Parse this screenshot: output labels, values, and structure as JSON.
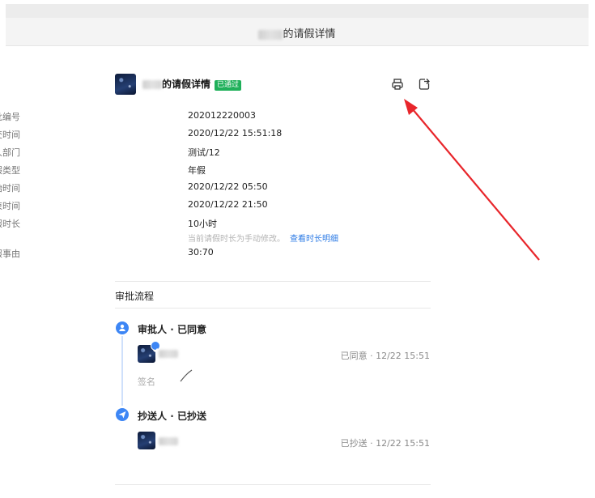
{
  "header": {
    "title_suffix": "的请假详情"
  },
  "card": {
    "title_suffix": "的请假详情",
    "badge": "已通过",
    "print_icon": "printer-icon",
    "export_icon": "export-icon"
  },
  "fields": [
    {
      "key": "审批编号",
      "value": "202012220003"
    },
    {
      "key": "提交时间",
      "value": "2020/12/22 15:51:18"
    },
    {
      "key": "申请人部门",
      "value": "测试/12"
    },
    {
      "key": "请假类型",
      "value": "年假"
    },
    {
      "key": "开始时间",
      "value": "2020/12/22 05:50"
    },
    {
      "key": "结束时间",
      "value": "2020/12/22 21:50"
    },
    {
      "key": "请假时长",
      "value": "10小时"
    },
    {
      "key": "请假事由",
      "value": "30:70"
    }
  ],
  "duration_hint": {
    "text": "当前请假时长为手动修改。",
    "link": "查看时长明细"
  },
  "process": {
    "title": "审批流程",
    "approver_node": {
      "title": "审批人",
      "sep": " · ",
      "state": "已同意",
      "status": "已同意 · 12/22 15:51",
      "sign_label": "签名"
    },
    "cc_node": {
      "title": "抄送人",
      "sep": " · ",
      "state": "已抄送",
      "status": "已抄送 · 12/22 15:51"
    }
  },
  "colors": {
    "accent": "#3d86f5",
    "badge": "#1fb05a",
    "link": "#2d7be5",
    "annotation_arrow": "#e8262b"
  }
}
